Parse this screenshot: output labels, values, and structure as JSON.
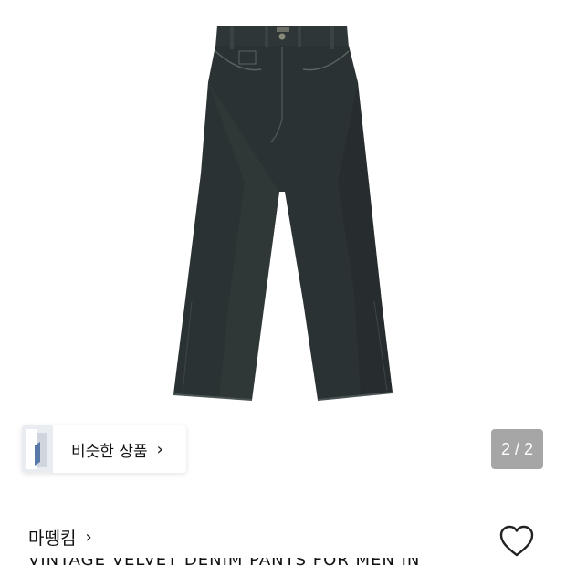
{
  "product": {
    "image_name": "denim-pants-photo",
    "brand": "마뗑킴",
    "title": "VINTAGE VELVET DENIM PANTS FOR MEN IN"
  },
  "similar": {
    "label": "비슷한 상품",
    "chevron": "›"
  },
  "gallery": {
    "counter": "2 / 2"
  },
  "brand_row": {
    "chevron": "›"
  },
  "icons": {
    "wishlist": "heart-outline-icon"
  },
  "colors": {
    "denim": "#2b3233",
    "counter_bg": "#a6a6a6"
  }
}
